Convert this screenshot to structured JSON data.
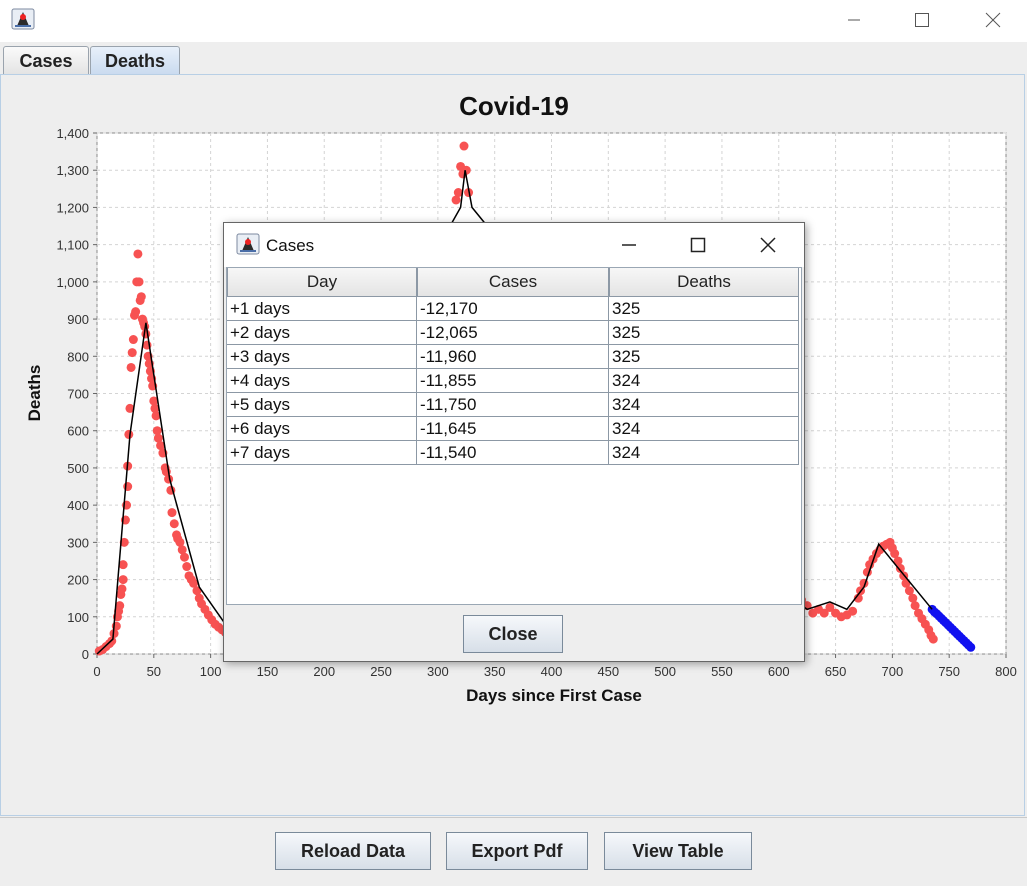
{
  "window": {
    "app_icon": "java-duke-icon",
    "controls": [
      "minimize-icon",
      "maximize-icon",
      "close-icon"
    ]
  },
  "tabs": [
    {
      "label": "Cases",
      "active": false
    },
    {
      "label": "Deaths",
      "active": true
    }
  ],
  "chart_data": {
    "type": "scatter",
    "title": "Covid-19",
    "xlabel": "Days since First Case",
    "ylabel": "Deaths",
    "xlim": [
      0,
      800
    ],
    "ylim": [
      0,
      1400
    ],
    "xticks": [
      "0",
      "50",
      "100",
      "150",
      "200",
      "250",
      "300",
      "350",
      "400",
      "450",
      "500",
      "550",
      "600",
      "650",
      "700",
      "750",
      "800"
    ],
    "yticks": [
      "0",
      "100",
      "200",
      "300",
      "400",
      "500",
      "600",
      "700",
      "800",
      "900",
      "1,000",
      "1,100",
      "1,200",
      "1,300",
      "1,400"
    ],
    "grid": true,
    "colors": {
      "actual": "#f75252",
      "forecast": "#1010f0",
      "trend": "#000000"
    },
    "series": [
      {
        "kind": "actual",
        "points": [
          [
            2,
            8
          ],
          [
            5,
            12
          ],
          [
            8,
            20
          ],
          [
            11,
            28
          ],
          [
            13,
            35
          ],
          [
            15,
            55
          ],
          [
            17,
            75
          ],
          [
            18,
            100
          ],
          [
            19,
            115
          ],
          [
            20,
            130
          ],
          [
            21,
            160
          ],
          [
            22,
            175
          ],
          [
            23,
            200
          ],
          [
            23,
            240
          ],
          [
            24,
            300
          ],
          [
            25,
            360
          ],
          [
            26,
            400
          ],
          [
            27,
            450
          ],
          [
            27,
            505
          ],
          [
            28,
            590
          ],
          [
            29,
            660
          ],
          [
            30,
            770
          ],
          [
            31,
            810
          ],
          [
            32,
            845
          ],
          [
            33,
            910
          ],
          [
            34,
            920
          ],
          [
            35,
            1000
          ],
          [
            36,
            1075
          ],
          [
            37,
            1000
          ],
          [
            38,
            950
          ],
          [
            39,
            960
          ],
          [
            40,
            900
          ],
          [
            41,
            890
          ],
          [
            42,
            880
          ],
          [
            43,
            860
          ],
          [
            44,
            830
          ],
          [
            45,
            800
          ],
          [
            46,
            780
          ],
          [
            47,
            760
          ],
          [
            48,
            740
          ],
          [
            49,
            720
          ],
          [
            50,
            680
          ],
          [
            51,
            660
          ],
          [
            52,
            640
          ],
          [
            53,
            600
          ],
          [
            54,
            580
          ],
          [
            56,
            560
          ],
          [
            58,
            540
          ],
          [
            60,
            500
          ],
          [
            61,
            490
          ],
          [
            63,
            470
          ],
          [
            65,
            440
          ],
          [
            66,
            380
          ],
          [
            68,
            350
          ],
          [
            70,
            320
          ],
          [
            71,
            310
          ],
          [
            73,
            300
          ],
          [
            75,
            280
          ],
          [
            77,
            260
          ],
          [
            79,
            235
          ],
          [
            81,
            210
          ],
          [
            83,
            200
          ],
          [
            85,
            190
          ],
          [
            88,
            170
          ],
          [
            90,
            150
          ],
          [
            92,
            135
          ],
          [
            95,
            120
          ],
          [
            98,
            105
          ],
          [
            101,
            92
          ],
          [
            104,
            80
          ],
          [
            107,
            72
          ],
          [
            110,
            65
          ],
          [
            113,
            58
          ],
          [
            316,
            1220
          ],
          [
            318,
            1240
          ],
          [
            320,
            1310
          ],
          [
            322,
            1290
          ],
          [
            323,
            1365
          ],
          [
            325,
            1300
          ],
          [
            327,
            1240
          ],
          [
            620,
            145
          ],
          [
            625,
            130
          ],
          [
            630,
            110
          ],
          [
            635,
            120
          ],
          [
            640,
            110
          ],
          [
            645,
            125
          ],
          [
            650,
            110
          ],
          [
            655,
            100
          ],
          [
            660,
            105
          ],
          [
            665,
            115
          ],
          [
            670,
            150
          ],
          [
            672,
            170
          ],
          [
            675,
            190
          ],
          [
            678,
            220
          ],
          [
            680,
            240
          ],
          [
            683,
            255
          ],
          [
            686,
            270
          ],
          [
            689,
            280
          ],
          [
            692,
            290
          ],
          [
            695,
            295
          ],
          [
            698,
            300
          ],
          [
            700,
            285
          ],
          [
            702,
            270
          ],
          [
            705,
            250
          ],
          [
            707,
            230
          ],
          [
            710,
            210
          ],
          [
            712,
            190
          ],
          [
            715,
            170
          ],
          [
            718,
            150
          ],
          [
            720,
            130
          ],
          [
            723,
            110
          ],
          [
            726,
            95
          ],
          [
            729,
            80
          ],
          [
            732,
            65
          ],
          [
            734,
            50
          ],
          [
            736,
            40
          ]
        ]
      },
      {
        "kind": "forecast",
        "points": [
          [
            735,
            120
          ],
          [
            737,
            113
          ],
          [
            739,
            108
          ],
          [
            741,
            102
          ],
          [
            743,
            96
          ],
          [
            745,
            90
          ],
          [
            747,
            84
          ],
          [
            749,
            78
          ],
          [
            751,
            72
          ],
          [
            753,
            66
          ],
          [
            755,
            60
          ],
          [
            757,
            54
          ],
          [
            759,
            48
          ],
          [
            761,
            42
          ],
          [
            763,
            36
          ],
          [
            765,
            30
          ],
          [
            767,
            24
          ],
          [
            769,
            18
          ]
        ]
      },
      {
        "kind": "trend",
        "points": [
          [
            0,
            0
          ],
          [
            14,
            40
          ],
          [
            29,
            590
          ],
          [
            43,
            890
          ],
          [
            64,
            470
          ],
          [
            90,
            180
          ],
          [
            113,
            80
          ],
          [
            320,
            1200
          ],
          [
            324,
            1300
          ],
          [
            330,
            1200
          ],
          [
            610,
            150
          ],
          [
            625,
            120
          ],
          [
            645,
            140
          ],
          [
            660,
            120
          ],
          [
            675,
            180
          ],
          [
            688,
            295
          ],
          [
            735,
            120
          ]
        ]
      }
    ]
  },
  "buttons": {
    "reload": "Reload Data",
    "export": "Export Pdf",
    "view": "View Table"
  },
  "dialog": {
    "title": "Cases",
    "columns": [
      "Day",
      "Cases",
      "Deaths"
    ],
    "rows": [
      [
        "+1 days",
        "-12,170",
        "325"
      ],
      [
        "+2 days",
        "-12,065",
        "325"
      ],
      [
        "+3 days",
        "-11,960",
        "325"
      ],
      [
        "+4 days",
        "-11,855",
        "324"
      ],
      [
        "+5 days",
        "-11,750",
        "324"
      ],
      [
        "+6 days",
        "-11,645",
        "324"
      ],
      [
        "+7 days",
        "-11,540",
        "324"
      ]
    ],
    "close_label": "Close"
  }
}
